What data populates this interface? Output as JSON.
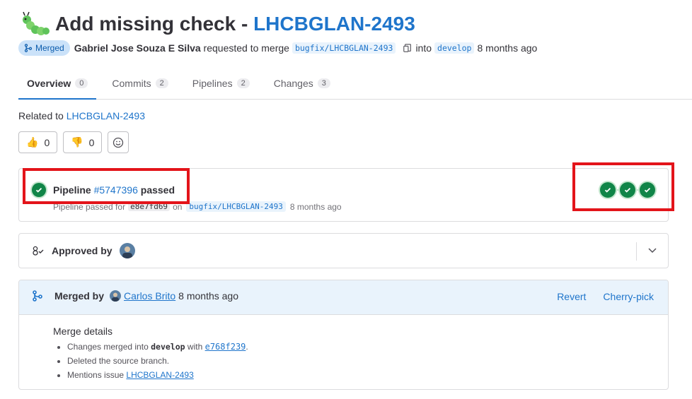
{
  "title": {
    "emoji": "caterpillar-icon",
    "text": "Add missing check - ",
    "issue": "LHCBGLAN-2493"
  },
  "meta": {
    "status_badge": "Merged",
    "author": "Gabriel Jose Souza E Silva",
    "requested_text": "requested to merge",
    "source_branch": "bugfix/LHCBGLAN-2493",
    "into_text": "into",
    "target_branch": "develop",
    "time": "8 months ago"
  },
  "tabs": [
    {
      "label": "Overview",
      "count": "0"
    },
    {
      "label": "Commits",
      "count": "2"
    },
    {
      "label": "Pipelines",
      "count": "2"
    },
    {
      "label": "Changes",
      "count": "3"
    }
  ],
  "related": {
    "prefix": "Related to",
    "link": "LHCBGLAN-2493"
  },
  "awards": {
    "thumbsup_count": "0",
    "thumbsdown_count": "0"
  },
  "pipeline": {
    "prefix": "Pipeline",
    "id": "#5747396",
    "status": "passed",
    "sub_prefix": "Pipeline passed for",
    "sha": "e8e7fd69",
    "on_text": "on",
    "branch": "bugfix/LHCBGLAN-2493",
    "time": "8 months ago",
    "stages": [
      "passed",
      "passed",
      "passed"
    ],
    "status_color": "#108548"
  },
  "approval": {
    "label": "Approved by"
  },
  "merged": {
    "prefix": "Merged by",
    "user": "Carlos Brito",
    "time": "8 months ago",
    "revert": "Revert",
    "cherry_pick": "Cherry-pick",
    "details_title": "Merge details",
    "detail1_prefix": "Changes merged into",
    "detail1_branch": "develop",
    "detail1_with": "with",
    "detail1_sha": "e768f239",
    "detail1_suffix": ".",
    "detail2": "Deleted the source branch.",
    "detail3_prefix": "Mentions issue",
    "detail3_link": "LHCBGLAN-2493"
  },
  "colors": {
    "link": "#1f75cb",
    "success": "#108548",
    "highlight": "#e3141a",
    "merged_bg": "#e9f3fc"
  }
}
